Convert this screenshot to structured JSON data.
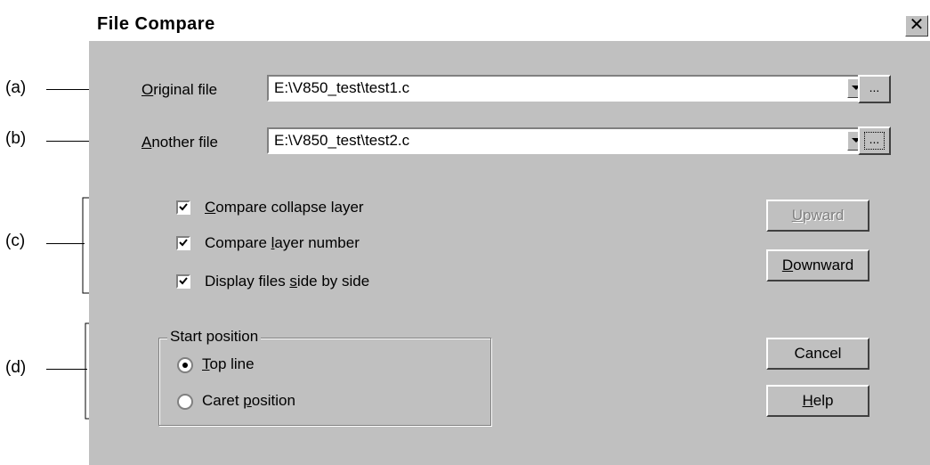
{
  "callouts": {
    "a": "(a)",
    "b": "(b)",
    "c": "(c)",
    "d": "(d)"
  },
  "dialog": {
    "title": "File Compare",
    "close_glyph": "✕"
  },
  "original_file": {
    "label_mnemonic": "O",
    "label_rest": "riginal file",
    "value": "E:\\V850_test\\test1.c",
    "browse_label": "..."
  },
  "another_file": {
    "label_mnemonic": "A",
    "label_rest": "nother file",
    "value": "E:\\V850_test\\test2.c",
    "browse_label": "..."
  },
  "options": [
    {
      "pre": "",
      "mnemonic": "C",
      "post": "ompare collapse layer",
      "checked": true
    },
    {
      "pre": "Compare ",
      "mnemonic": "l",
      "post": "ayer number",
      "checked": true
    },
    {
      "pre": "Display files ",
      "mnemonic": "s",
      "post": "ide by side",
      "checked": true
    }
  ],
  "start_position": {
    "title": "Start position",
    "top_line": {
      "mnemonic": "T",
      "rest": "op line",
      "selected": true
    },
    "caret": {
      "pre": "Caret ",
      "mnemonic": "p",
      "post": "osition",
      "selected": false
    }
  },
  "buttons": {
    "upward": {
      "mnemonic": "U",
      "rest": "pward",
      "enabled": false
    },
    "downward": {
      "mnemonic": "D",
      "rest": "ownward",
      "enabled": true
    },
    "cancel": "Cancel",
    "help": {
      "mnemonic": "H",
      "rest": "elp"
    }
  },
  "colors": {
    "dialog_bg": "#c0c0c0",
    "disabled_text": "#808080"
  }
}
